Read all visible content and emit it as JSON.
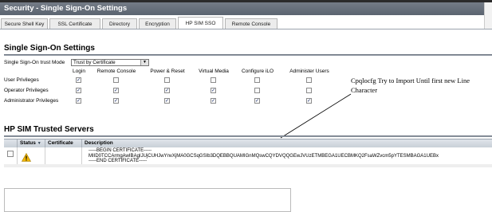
{
  "window": {
    "title": "Security - Single Sign-On Settings"
  },
  "tabs": [
    {
      "label": "Secure Shell Key"
    },
    {
      "label": "SSL Certificate"
    },
    {
      "label": "Directory"
    },
    {
      "label": "Encryption"
    },
    {
      "label": "HP SIM SSO",
      "active": true
    },
    {
      "label": "Remote Console"
    }
  ],
  "sso": {
    "heading": "Single Sign-On Settings",
    "trust_mode_label": "Single Sign-On trust Mode",
    "trust_mode_value": "Trust by Certificate",
    "columns": [
      "Login",
      "Remote Console",
      "Power & Reset",
      "Virtual Media",
      "Configure iLO",
      "Administer Users"
    ],
    "rows": [
      {
        "label": "User Privileges",
        "checked": [
          true,
          false,
          false,
          false,
          false,
          false
        ]
      },
      {
        "label": "Operator Privileges",
        "checked": [
          true,
          true,
          true,
          true,
          false,
          false
        ]
      },
      {
        "label": "Administrator Privileges",
        "checked": [
          true,
          true,
          true,
          true,
          true,
          true
        ]
      }
    ]
  },
  "annotation": {
    "text": "Cpqlocfg Try to Import Until first new Line Character"
  },
  "servers": {
    "heading": "HP SIM Trusted Servers",
    "columns": {
      "status": "Status",
      "certificate": "Certificate",
      "description": "Description"
    },
    "row": {
      "status_icon": "warning-icon",
      "description_lines": [
        "-----BEGIN CERTIFICATE-----",
        "MIID0TCCArmgAwIBAgIJUjCUHJwYnvXjMA0GCSqGSIb3DQEBBQUAMIGnMQswCQYDVQQGEwJVUzETMBEGA1UECBMKQ2FsaWZvcm5pYTESMBAGA1UEBx",
        "-----END CERTIFICATE-----"
      ]
    }
  },
  "colors": {
    "title_bar": "#5f6874",
    "accent_check": "#1b2f6b",
    "warning": "#f2b705"
  }
}
